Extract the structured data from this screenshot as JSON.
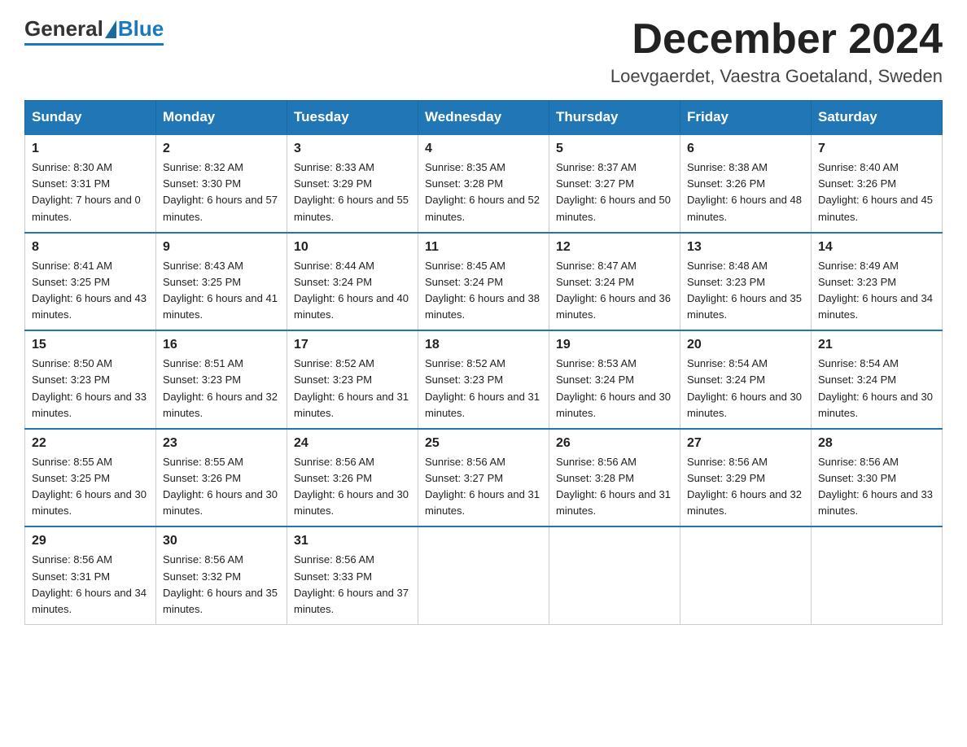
{
  "header": {
    "logo_general": "General",
    "logo_blue": "Blue",
    "month_title": "December 2024",
    "location": "Loevgaerdet, Vaestra Goetaland, Sweden"
  },
  "days_of_week": [
    "Sunday",
    "Monday",
    "Tuesday",
    "Wednesday",
    "Thursday",
    "Friday",
    "Saturday"
  ],
  "weeks": [
    [
      {
        "day": "1",
        "sunrise": "8:30 AM",
        "sunset": "3:31 PM",
        "daylight": "7 hours and 0 minutes."
      },
      {
        "day": "2",
        "sunrise": "8:32 AM",
        "sunset": "3:30 PM",
        "daylight": "6 hours and 57 minutes."
      },
      {
        "day": "3",
        "sunrise": "8:33 AM",
        "sunset": "3:29 PM",
        "daylight": "6 hours and 55 minutes."
      },
      {
        "day": "4",
        "sunrise": "8:35 AM",
        "sunset": "3:28 PM",
        "daylight": "6 hours and 52 minutes."
      },
      {
        "day": "5",
        "sunrise": "8:37 AM",
        "sunset": "3:27 PM",
        "daylight": "6 hours and 50 minutes."
      },
      {
        "day": "6",
        "sunrise": "8:38 AM",
        "sunset": "3:26 PM",
        "daylight": "6 hours and 48 minutes."
      },
      {
        "day": "7",
        "sunrise": "8:40 AM",
        "sunset": "3:26 PM",
        "daylight": "6 hours and 45 minutes."
      }
    ],
    [
      {
        "day": "8",
        "sunrise": "8:41 AM",
        "sunset": "3:25 PM",
        "daylight": "6 hours and 43 minutes."
      },
      {
        "day": "9",
        "sunrise": "8:43 AM",
        "sunset": "3:25 PM",
        "daylight": "6 hours and 41 minutes."
      },
      {
        "day": "10",
        "sunrise": "8:44 AM",
        "sunset": "3:24 PM",
        "daylight": "6 hours and 40 minutes."
      },
      {
        "day": "11",
        "sunrise": "8:45 AM",
        "sunset": "3:24 PM",
        "daylight": "6 hours and 38 minutes."
      },
      {
        "day": "12",
        "sunrise": "8:47 AM",
        "sunset": "3:24 PM",
        "daylight": "6 hours and 36 minutes."
      },
      {
        "day": "13",
        "sunrise": "8:48 AM",
        "sunset": "3:23 PM",
        "daylight": "6 hours and 35 minutes."
      },
      {
        "day": "14",
        "sunrise": "8:49 AM",
        "sunset": "3:23 PM",
        "daylight": "6 hours and 34 minutes."
      }
    ],
    [
      {
        "day": "15",
        "sunrise": "8:50 AM",
        "sunset": "3:23 PM",
        "daylight": "6 hours and 33 minutes."
      },
      {
        "day": "16",
        "sunrise": "8:51 AM",
        "sunset": "3:23 PM",
        "daylight": "6 hours and 32 minutes."
      },
      {
        "day": "17",
        "sunrise": "8:52 AM",
        "sunset": "3:23 PM",
        "daylight": "6 hours and 31 minutes."
      },
      {
        "day": "18",
        "sunrise": "8:52 AM",
        "sunset": "3:23 PM",
        "daylight": "6 hours and 31 minutes."
      },
      {
        "day": "19",
        "sunrise": "8:53 AM",
        "sunset": "3:24 PM",
        "daylight": "6 hours and 30 minutes."
      },
      {
        "day": "20",
        "sunrise": "8:54 AM",
        "sunset": "3:24 PM",
        "daylight": "6 hours and 30 minutes."
      },
      {
        "day": "21",
        "sunrise": "8:54 AM",
        "sunset": "3:24 PM",
        "daylight": "6 hours and 30 minutes."
      }
    ],
    [
      {
        "day": "22",
        "sunrise": "8:55 AM",
        "sunset": "3:25 PM",
        "daylight": "6 hours and 30 minutes."
      },
      {
        "day": "23",
        "sunrise": "8:55 AM",
        "sunset": "3:26 PM",
        "daylight": "6 hours and 30 minutes."
      },
      {
        "day": "24",
        "sunrise": "8:56 AM",
        "sunset": "3:26 PM",
        "daylight": "6 hours and 30 minutes."
      },
      {
        "day": "25",
        "sunrise": "8:56 AM",
        "sunset": "3:27 PM",
        "daylight": "6 hours and 31 minutes."
      },
      {
        "day": "26",
        "sunrise": "8:56 AM",
        "sunset": "3:28 PM",
        "daylight": "6 hours and 31 minutes."
      },
      {
        "day": "27",
        "sunrise": "8:56 AM",
        "sunset": "3:29 PM",
        "daylight": "6 hours and 32 minutes."
      },
      {
        "day": "28",
        "sunrise": "8:56 AM",
        "sunset": "3:30 PM",
        "daylight": "6 hours and 33 minutes."
      }
    ],
    [
      {
        "day": "29",
        "sunrise": "8:56 AM",
        "sunset": "3:31 PM",
        "daylight": "6 hours and 34 minutes."
      },
      {
        "day": "30",
        "sunrise": "8:56 AM",
        "sunset": "3:32 PM",
        "daylight": "6 hours and 35 minutes."
      },
      {
        "day": "31",
        "sunrise": "8:56 AM",
        "sunset": "3:33 PM",
        "daylight": "6 hours and 37 minutes."
      },
      null,
      null,
      null,
      null
    ]
  ]
}
